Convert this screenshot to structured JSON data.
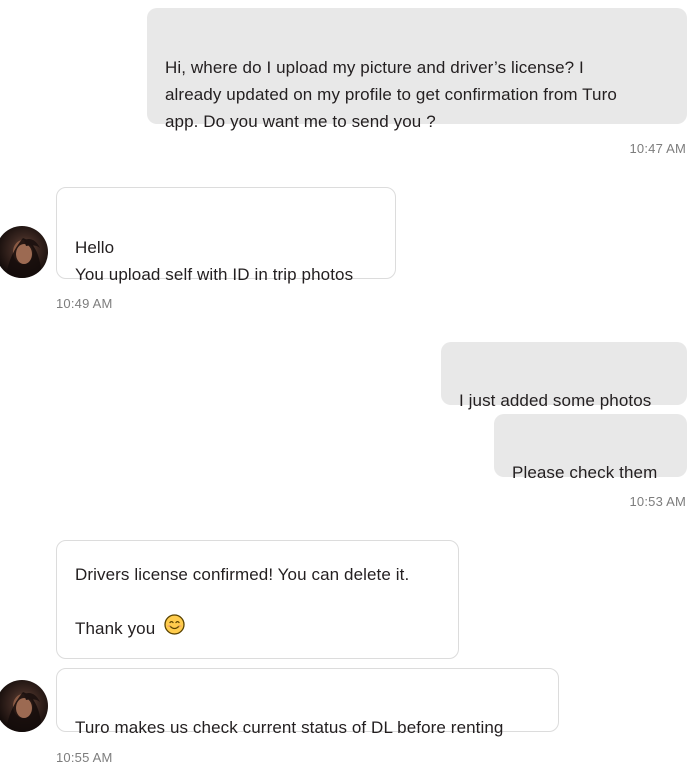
{
  "messages": {
    "m1": {
      "text": "Hi, where do I upload my picture and driver’s license? I\nalready updated on my profile to get confirmation from Turo\napp. Do you want me to send you ?",
      "time": "10:47 AM"
    },
    "m2": {
      "text": "Hello\nYou upload self with ID in trip photos",
      "time": "10:49 AM"
    },
    "m3": {
      "text": "I just added some photos"
    },
    "m4": {
      "text": "Please check them",
      "time": "10:53 AM"
    },
    "m5": {
      "line1": "Drivers license confirmed! You can delete it.",
      "line2": "Thank you",
      "emoji": "smiling-face-icon"
    },
    "m6": {
      "text": "Turo makes us check current status of DL before renting",
      "time": "10:55 AM"
    }
  },
  "colors": {
    "outgoing_bubble": "#e8e8e8",
    "incoming_border": "#dcdcdc",
    "timestamp": "#7d7d7d",
    "text": "#231f20"
  }
}
